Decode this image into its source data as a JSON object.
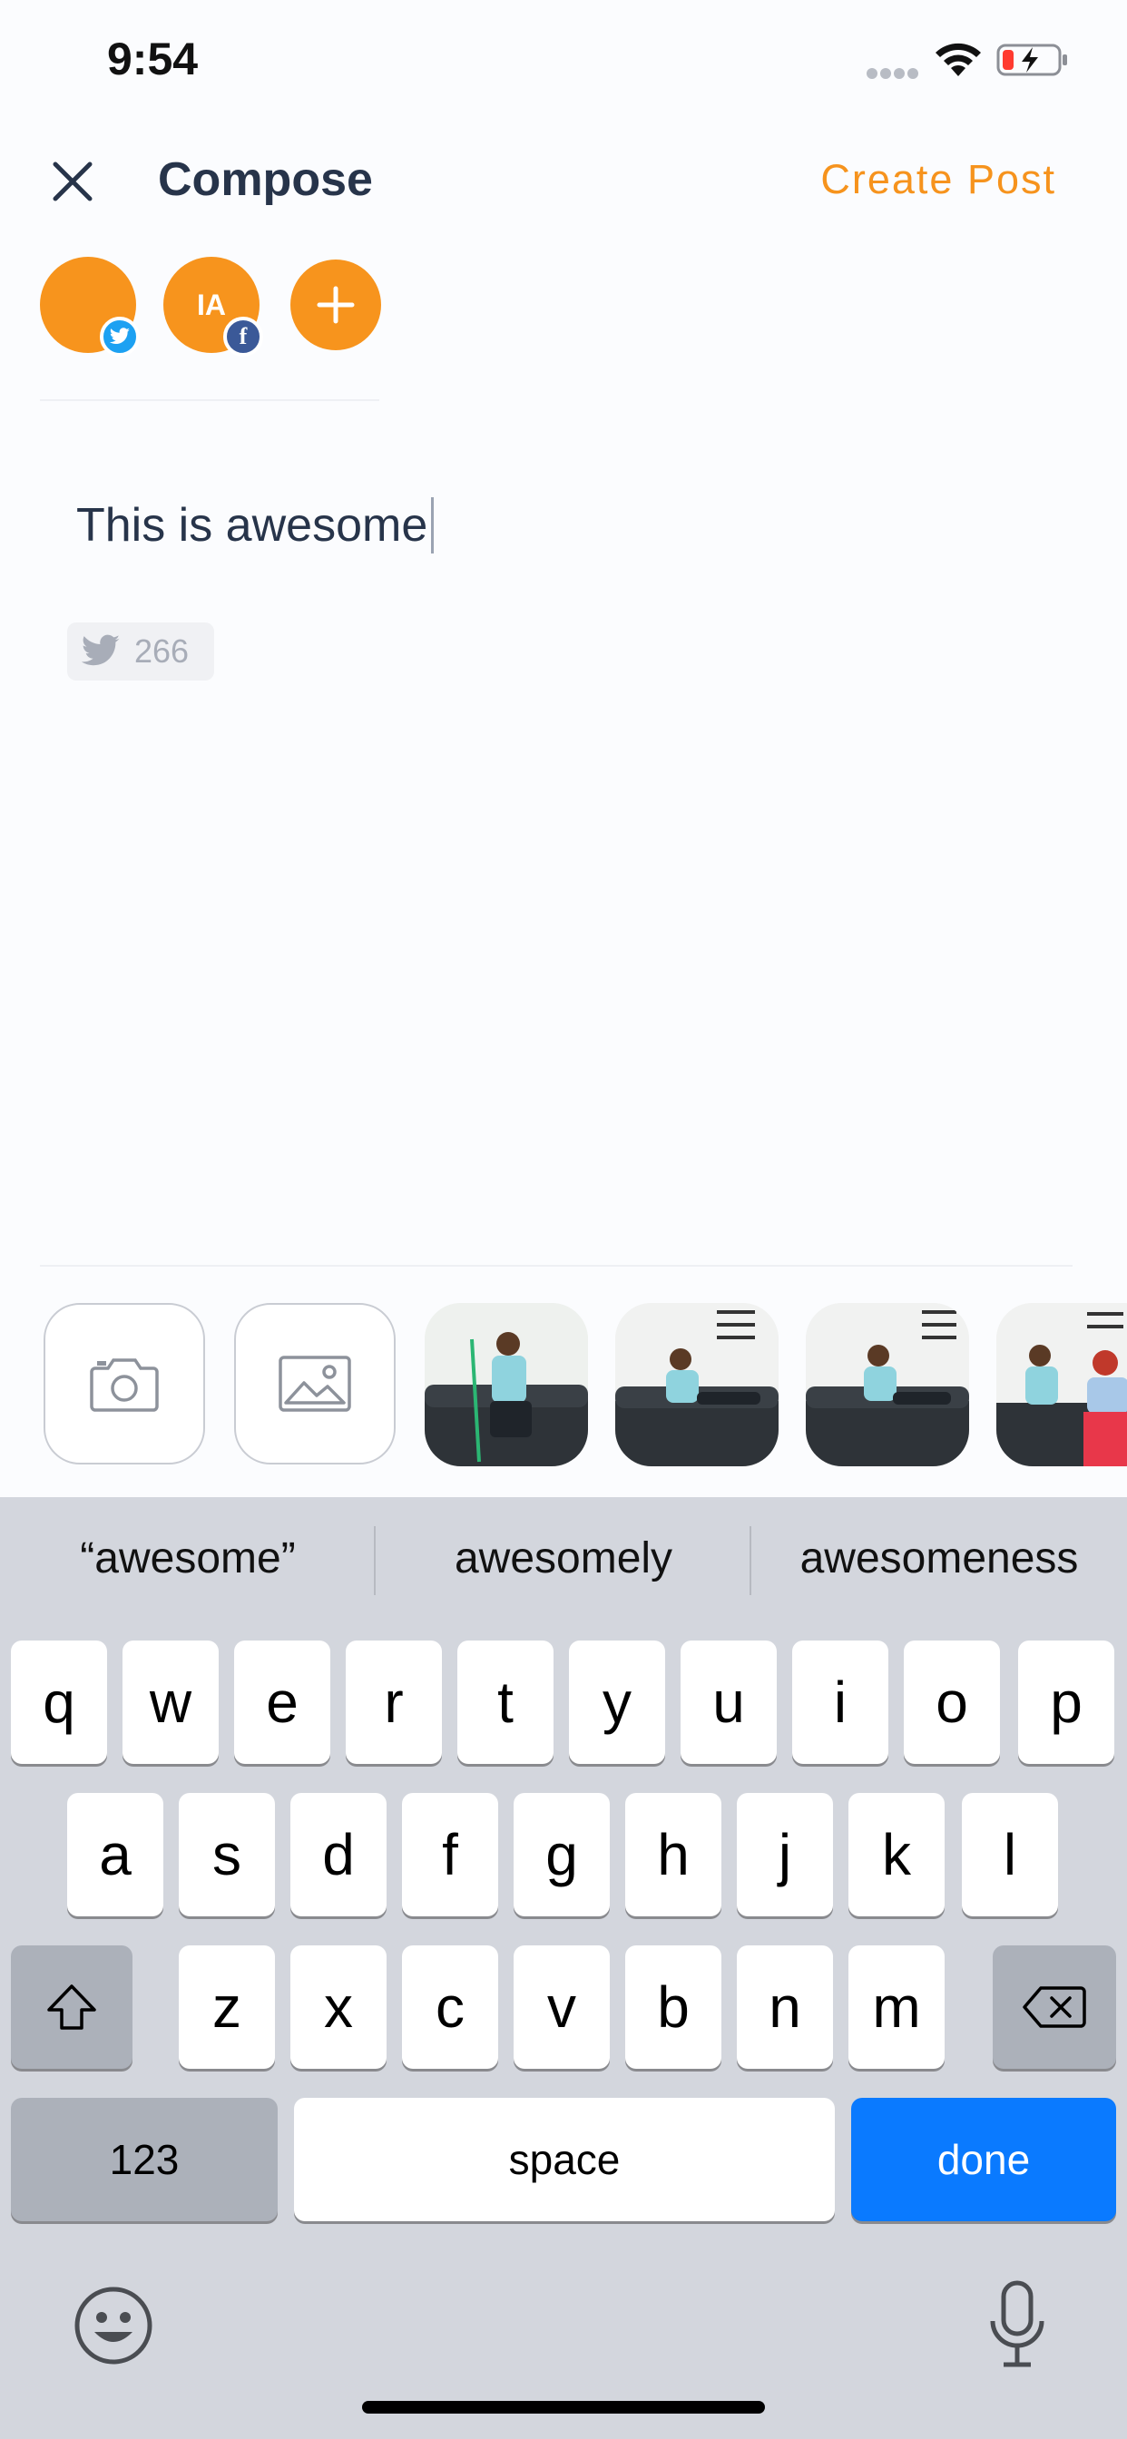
{
  "status_bar": {
    "time": "9:54",
    "icons": [
      "signal-dots-icon",
      "wifi-icon",
      "battery-charging-icon"
    ]
  },
  "header": {
    "close_icon": "close-icon",
    "title": "Compose",
    "create_post_label": "Create Post",
    "accent_color": "#f7941d"
  },
  "accounts": {
    "items": [
      {
        "initials": "",
        "network": "twitter"
      },
      {
        "initials": "IA",
        "network": "facebook"
      }
    ],
    "facebook_badge": "f",
    "add_icon": "plus-icon"
  },
  "compose": {
    "text": "This is awesome",
    "counter_icon": "twitter-bird-icon",
    "remaining_chars": "266"
  },
  "media": {
    "camera_icon": "camera-icon",
    "gallery_icon": "image-gallery-icon",
    "photos": [
      "photo-1",
      "photo-2",
      "photo-3",
      "photo-4"
    ]
  },
  "keyboard": {
    "suggestions": [
      "“awesome”",
      "awesomely",
      "awesomeness"
    ],
    "row1": [
      "q",
      "w",
      "e",
      "r",
      "t",
      "y",
      "u",
      "i",
      "o",
      "p"
    ],
    "row2": [
      "a",
      "s",
      "d",
      "f",
      "g",
      "h",
      "j",
      "k",
      "l"
    ],
    "row3": [
      "z",
      "x",
      "c",
      "v",
      "b",
      "n",
      "m"
    ],
    "numbers_label": "123",
    "space_label": "space",
    "done_label": "done",
    "done_color": "#0a7aff"
  }
}
